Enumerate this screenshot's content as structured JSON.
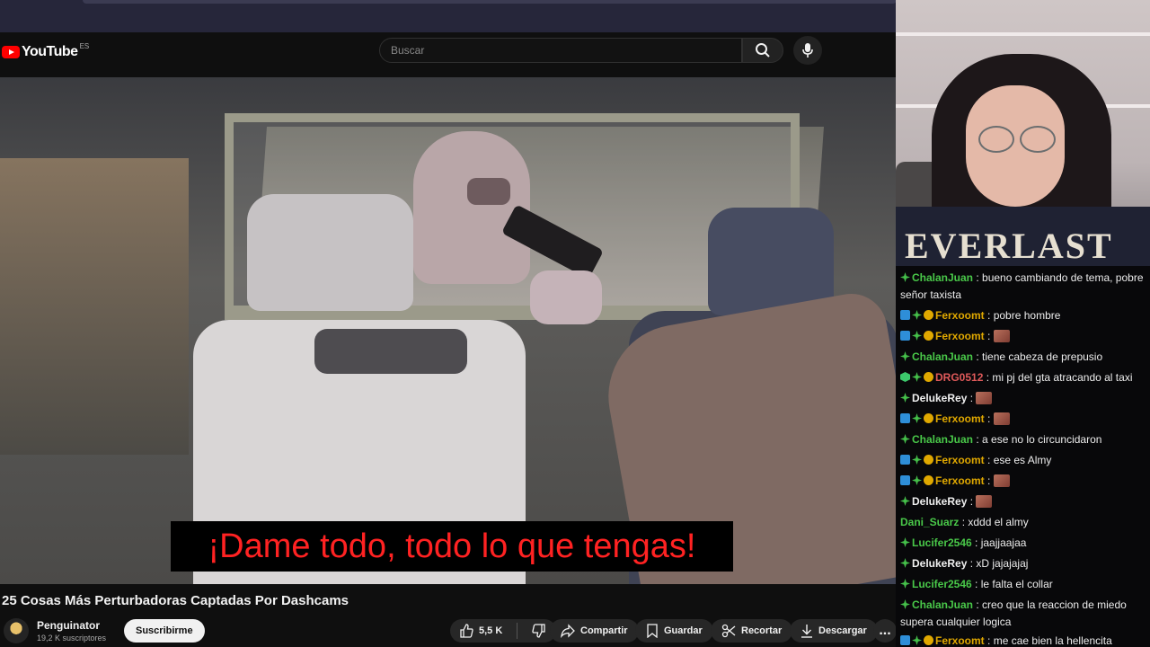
{
  "youtube": {
    "logo_text": "YouTube",
    "region": "ES",
    "search_placeholder": "Buscar"
  },
  "video": {
    "subtitle": "¡Dame todo, todo lo que tengas!",
    "title": "25 Cosas Más Perturbadoras Captadas Por Dashcams"
  },
  "channel": {
    "name": "Penguinator",
    "subscribers": "19,2 K suscriptores",
    "subscribe_label": "Suscribirme"
  },
  "actions": {
    "likes": "5,5 K",
    "share": "Compartir",
    "save": "Guardar",
    "clip": "Recortar",
    "download": "Descargar",
    "more": "..."
  },
  "webcam": {
    "shirt_text": "EVERLAST"
  },
  "chat": {
    "messages": [
      {
        "badges": [
          "green"
        ],
        "user": "ChalanJuan",
        "color": "#49c849",
        "text": "bueno cambiando de tema, pobre señor taxista",
        "emote": false
      },
      {
        "badges": [
          "blue",
          "green",
          "gold"
        ],
        "user": "Ferxoomt",
        "color": "#e0a800",
        "text": "pobre hombre",
        "emote": false
      },
      {
        "badges": [
          "blue",
          "green",
          "gold"
        ],
        "user": "Ferxoomt",
        "color": "#e0a800",
        "text": "",
        "emote": true
      },
      {
        "badges": [
          "green"
        ],
        "user": "ChalanJuan",
        "color": "#49c849",
        "text": "tiene cabeza de prepusio",
        "emote": false
      },
      {
        "badges": [
          "cube",
          "green",
          "gold"
        ],
        "user": "DRG0512",
        "color": "#e05a5a",
        "text": "mi pj del gta atracando al taxi",
        "emote": false
      },
      {
        "badges": [
          "green"
        ],
        "user": "DelukeRey",
        "color": "#f0f0f0",
        "text": "",
        "emote": true
      },
      {
        "badges": [
          "blue",
          "green",
          "gold"
        ],
        "user": "Ferxoomt",
        "color": "#e0a800",
        "text": "",
        "emote": true
      },
      {
        "badges": [
          "green"
        ],
        "user": "ChalanJuan",
        "color": "#49c849",
        "text": "a ese no lo circuncidaron",
        "emote": false
      },
      {
        "badges": [
          "blue",
          "green",
          "gold"
        ],
        "user": "Ferxoomt",
        "color": "#e0a800",
        "text": "ese es Almy",
        "emote": false
      },
      {
        "badges": [
          "blue",
          "green",
          "gold"
        ],
        "user": "Ferxoomt",
        "color": "#e0a800",
        "text": "",
        "emote": true
      },
      {
        "badges": [
          "green"
        ],
        "user": "DelukeRey",
        "color": "#f0f0f0",
        "text": "",
        "emote": true
      },
      {
        "badges": [],
        "user": "Dani_Suarz",
        "color": "#49c849",
        "text": "xddd el almy",
        "emote": false
      },
      {
        "badges": [
          "green"
        ],
        "user": "Lucifer2546",
        "color": "#49c849",
        "text": "jaajjaajaa",
        "emote": false
      },
      {
        "badges": [
          "green"
        ],
        "user": "DelukeRey",
        "color": "#f0f0f0",
        "text": "xD jajajajaj",
        "emote": false
      },
      {
        "badges": [
          "green"
        ],
        "user": "Lucifer2546",
        "color": "#49c849",
        "text": "le falta el collar",
        "emote": false
      },
      {
        "badges": [
          "green"
        ],
        "user": "ChalanJuan",
        "color": "#49c849",
        "text": "creo que la reaccion de miedo supera cualquier logica",
        "emote": false
      },
      {
        "badges": [
          "blue",
          "green",
          "gold"
        ],
        "user": "Ferxoomt",
        "color": "#e0a800",
        "text": "me cae bien la hellencita",
        "emote": false
      }
    ]
  }
}
